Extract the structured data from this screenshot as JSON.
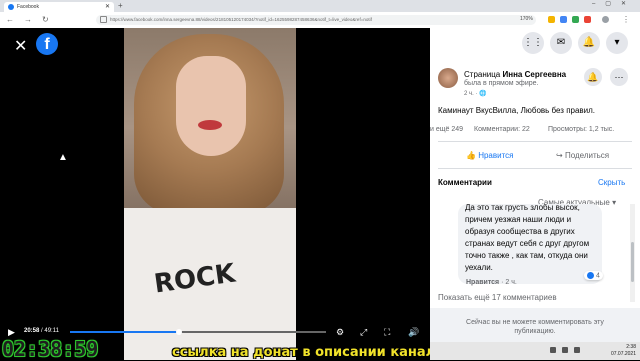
{
  "browser": {
    "tab_title": "Facebook",
    "url": "https://www.facebook.com/inna.sergeevna.88/videos/218105120174034/?notif_id=1625598287458636&notif_t=live_video&ref=notif",
    "zoom": "170%"
  },
  "video": {
    "shirt_text": "ROCK",
    "current_time": "20:58",
    "duration": "/ 49:11",
    "progress_fraction": 0.427,
    "overlay_timer": "02:38:59",
    "overlay_banner": "ссылка на донат в описании канала"
  },
  "panel": {
    "page_prefix": "Страница",
    "page_name": "Инна Сергеевна",
    "status": "была в прямом эфире.",
    "time_ago": "2 ч. ·",
    "description": "Каминаут ВкусВилла, Любовь без правил.",
    "stats": {
      "reactions": "и ещё 249",
      "comments": "Комментарии: 22",
      "views": "Просмотры: 1,2 тыс."
    },
    "like_label": "Нравится",
    "share_label": "Поделиться",
    "comments_title": "Комментарии",
    "follow_label": "Скрыть",
    "sort_label": "Самые актуальные",
    "comment_text": "Да это так грусть злобы высок, причем уезжая наши люди и образуя сообщества в других странах ведут себя с друг другом точно также , как там, откуда они уехали.",
    "comment_likes": "4",
    "comment_like_btn": "Нравится",
    "comment_time": "· 2 ч.",
    "show_more": "Показать ещё 17 комментариев",
    "footer_text": "Сейчас вы не можете комментировать эту публикацию."
  },
  "taskbar": {
    "time": "2:38",
    "date": "07.07.2021"
  }
}
